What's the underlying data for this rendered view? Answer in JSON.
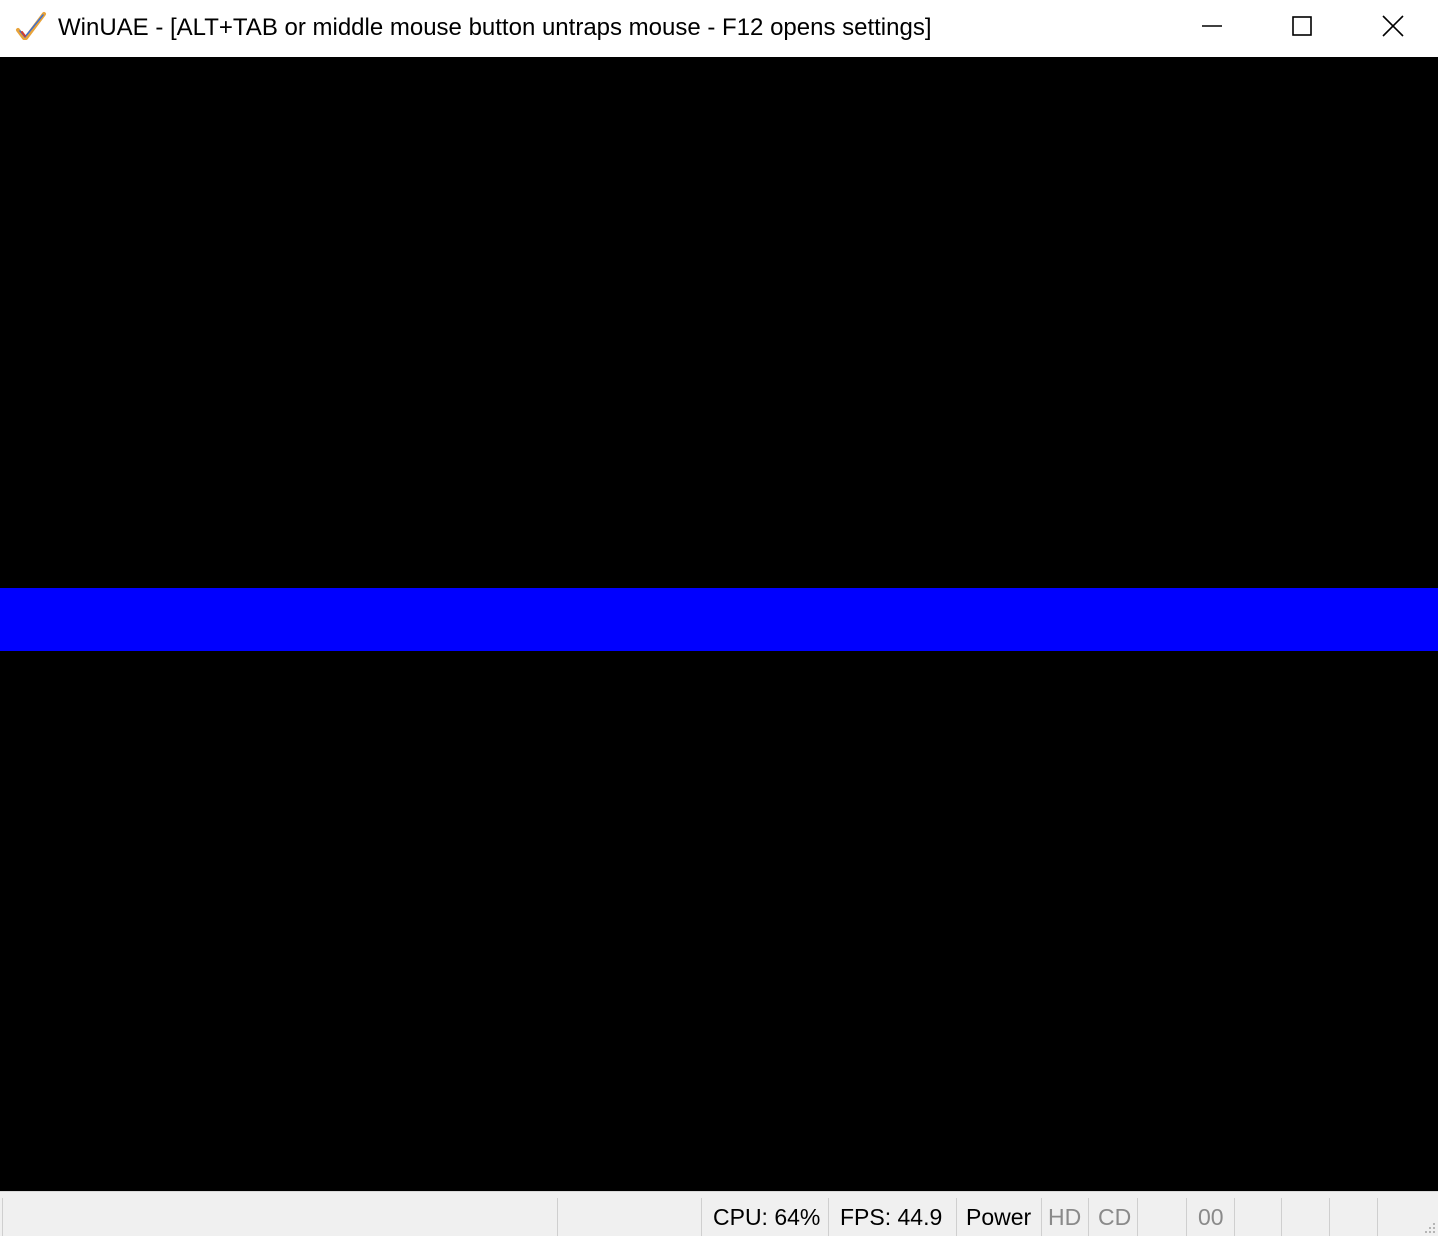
{
  "window": {
    "title": "WinUAE - [ALT+TAB or middle mouse button untraps mouse - F12 opens settings]",
    "icon": "winuae-checkmark-icon",
    "controls": {
      "minimize": "minimize-icon",
      "maximize": "maximize-icon",
      "close": "close-icon"
    }
  },
  "screen": {
    "background": "#000000",
    "bar_color": "#0000ff"
  },
  "statusbar": {
    "cpu": "CPU: 64%",
    "fps": "FPS: 44.9",
    "power": "Power",
    "hd": "HD",
    "cd": "CD",
    "drive_counter": "00"
  }
}
